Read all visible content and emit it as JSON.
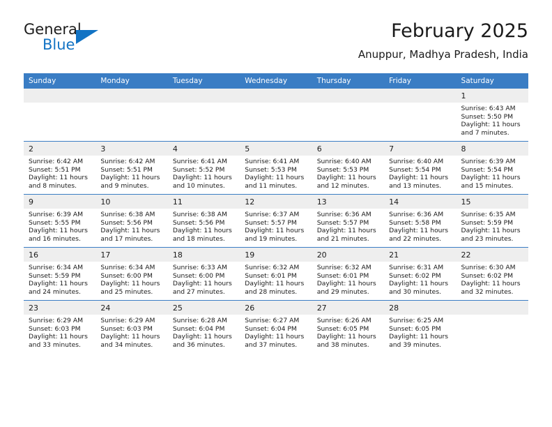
{
  "brand": {
    "name_part1": "General",
    "name_part2": "Blue",
    "accent_color": "#1273c4"
  },
  "header": {
    "title": "February 2025",
    "location": "Anuppur, Madhya Pradesh, India"
  },
  "theme": {
    "header_row_color": "#3a7dc4",
    "daynum_band_color": "#eeeeee",
    "text_color": "#1a1a1a"
  },
  "weekday_headers": [
    "Sunday",
    "Monday",
    "Tuesday",
    "Wednesday",
    "Thursday",
    "Friday",
    "Saturday"
  ],
  "weeks": [
    [
      {
        "day": "",
        "sunrise": "",
        "sunset": "",
        "daylight": ""
      },
      {
        "day": "",
        "sunrise": "",
        "sunset": "",
        "daylight": ""
      },
      {
        "day": "",
        "sunrise": "",
        "sunset": "",
        "daylight": ""
      },
      {
        "day": "",
        "sunrise": "",
        "sunset": "",
        "daylight": ""
      },
      {
        "day": "",
        "sunrise": "",
        "sunset": "",
        "daylight": ""
      },
      {
        "day": "",
        "sunrise": "",
        "sunset": "",
        "daylight": ""
      },
      {
        "day": "1",
        "sunrise": "Sunrise: 6:43 AM",
        "sunset": "Sunset: 5:50 PM",
        "daylight": "Daylight: 11 hours and 7 minutes."
      }
    ],
    [
      {
        "day": "2",
        "sunrise": "Sunrise: 6:42 AM",
        "sunset": "Sunset: 5:51 PM",
        "daylight": "Daylight: 11 hours and 8 minutes."
      },
      {
        "day": "3",
        "sunrise": "Sunrise: 6:42 AM",
        "sunset": "Sunset: 5:51 PM",
        "daylight": "Daylight: 11 hours and 9 minutes."
      },
      {
        "day": "4",
        "sunrise": "Sunrise: 6:41 AM",
        "sunset": "Sunset: 5:52 PM",
        "daylight": "Daylight: 11 hours and 10 minutes."
      },
      {
        "day": "5",
        "sunrise": "Sunrise: 6:41 AM",
        "sunset": "Sunset: 5:53 PM",
        "daylight": "Daylight: 11 hours and 11 minutes."
      },
      {
        "day": "6",
        "sunrise": "Sunrise: 6:40 AM",
        "sunset": "Sunset: 5:53 PM",
        "daylight": "Daylight: 11 hours and 12 minutes."
      },
      {
        "day": "7",
        "sunrise": "Sunrise: 6:40 AM",
        "sunset": "Sunset: 5:54 PM",
        "daylight": "Daylight: 11 hours and 13 minutes."
      },
      {
        "day": "8",
        "sunrise": "Sunrise: 6:39 AM",
        "sunset": "Sunset: 5:54 PM",
        "daylight": "Daylight: 11 hours and 15 minutes."
      }
    ],
    [
      {
        "day": "9",
        "sunrise": "Sunrise: 6:39 AM",
        "sunset": "Sunset: 5:55 PM",
        "daylight": "Daylight: 11 hours and 16 minutes."
      },
      {
        "day": "10",
        "sunrise": "Sunrise: 6:38 AM",
        "sunset": "Sunset: 5:56 PM",
        "daylight": "Daylight: 11 hours and 17 minutes."
      },
      {
        "day": "11",
        "sunrise": "Sunrise: 6:38 AM",
        "sunset": "Sunset: 5:56 PM",
        "daylight": "Daylight: 11 hours and 18 minutes."
      },
      {
        "day": "12",
        "sunrise": "Sunrise: 6:37 AM",
        "sunset": "Sunset: 5:57 PM",
        "daylight": "Daylight: 11 hours and 19 minutes."
      },
      {
        "day": "13",
        "sunrise": "Sunrise: 6:36 AM",
        "sunset": "Sunset: 5:57 PM",
        "daylight": "Daylight: 11 hours and 21 minutes."
      },
      {
        "day": "14",
        "sunrise": "Sunrise: 6:36 AM",
        "sunset": "Sunset: 5:58 PM",
        "daylight": "Daylight: 11 hours and 22 minutes."
      },
      {
        "day": "15",
        "sunrise": "Sunrise: 6:35 AM",
        "sunset": "Sunset: 5:59 PM",
        "daylight": "Daylight: 11 hours and 23 minutes."
      }
    ],
    [
      {
        "day": "16",
        "sunrise": "Sunrise: 6:34 AM",
        "sunset": "Sunset: 5:59 PM",
        "daylight": "Daylight: 11 hours and 24 minutes."
      },
      {
        "day": "17",
        "sunrise": "Sunrise: 6:34 AM",
        "sunset": "Sunset: 6:00 PM",
        "daylight": "Daylight: 11 hours and 25 minutes."
      },
      {
        "day": "18",
        "sunrise": "Sunrise: 6:33 AM",
        "sunset": "Sunset: 6:00 PM",
        "daylight": "Daylight: 11 hours and 27 minutes."
      },
      {
        "day": "19",
        "sunrise": "Sunrise: 6:32 AM",
        "sunset": "Sunset: 6:01 PM",
        "daylight": "Daylight: 11 hours and 28 minutes."
      },
      {
        "day": "20",
        "sunrise": "Sunrise: 6:32 AM",
        "sunset": "Sunset: 6:01 PM",
        "daylight": "Daylight: 11 hours and 29 minutes."
      },
      {
        "day": "21",
        "sunrise": "Sunrise: 6:31 AM",
        "sunset": "Sunset: 6:02 PM",
        "daylight": "Daylight: 11 hours and 30 minutes."
      },
      {
        "day": "22",
        "sunrise": "Sunrise: 6:30 AM",
        "sunset": "Sunset: 6:02 PM",
        "daylight": "Daylight: 11 hours and 32 minutes."
      }
    ],
    [
      {
        "day": "23",
        "sunrise": "Sunrise: 6:29 AM",
        "sunset": "Sunset: 6:03 PM",
        "daylight": "Daylight: 11 hours and 33 minutes."
      },
      {
        "day": "24",
        "sunrise": "Sunrise: 6:29 AM",
        "sunset": "Sunset: 6:03 PM",
        "daylight": "Daylight: 11 hours and 34 minutes."
      },
      {
        "day": "25",
        "sunrise": "Sunrise: 6:28 AM",
        "sunset": "Sunset: 6:04 PM",
        "daylight": "Daylight: 11 hours and 36 minutes."
      },
      {
        "day": "26",
        "sunrise": "Sunrise: 6:27 AM",
        "sunset": "Sunset: 6:04 PM",
        "daylight": "Daylight: 11 hours and 37 minutes."
      },
      {
        "day": "27",
        "sunrise": "Sunrise: 6:26 AM",
        "sunset": "Sunset: 6:05 PM",
        "daylight": "Daylight: 11 hours and 38 minutes."
      },
      {
        "day": "28",
        "sunrise": "Sunrise: 6:25 AM",
        "sunset": "Sunset: 6:05 PM",
        "daylight": "Daylight: 11 hours and 39 minutes."
      },
      {
        "day": "",
        "sunrise": "",
        "sunset": "",
        "daylight": ""
      }
    ]
  ]
}
